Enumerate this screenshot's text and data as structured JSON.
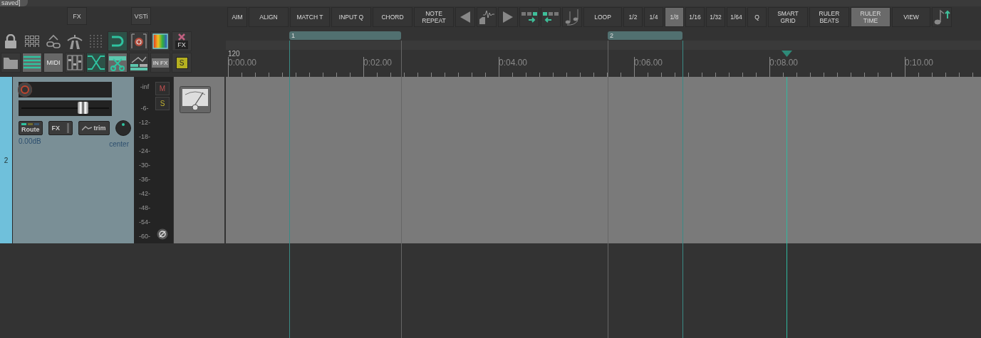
{
  "project_tab": {
    "title": "saved]"
  },
  "left_buttons": [
    {
      "label": "FX"
    },
    {
      "label": "VSTi"
    }
  ],
  "left_icon_rows": [
    [
      {
        "kind": "lock",
        "on": false
      },
      {
        "kind": "grid",
        "on": false
      },
      {
        "kind": "link",
        "on": false
      },
      {
        "kind": "road",
        "on": false
      },
      {
        "kind": "dots",
        "on": false
      },
      {
        "kind": "magnet",
        "on": true
      },
      {
        "kind": "record",
        "on": false
      },
      {
        "kind": "spectrum",
        "on": false
      },
      {
        "kind": "delete-fx",
        "label": "FX",
        "on": false
      }
    ],
    [
      {
        "kind": "folder",
        "on": false
      },
      {
        "kind": "lines",
        "on": true
      },
      {
        "kind": "text",
        "label": "MIDI",
        "on": true
      },
      {
        "kind": "mixer",
        "on": false
      },
      {
        "kind": "crossfade",
        "on": true
      },
      {
        "kind": "scissors",
        "on": true
      },
      {
        "kind": "envelope",
        "on": false
      },
      {
        "kind": "in-fx",
        "label": "IN FX",
        "on": false
      },
      {
        "kind": "solo",
        "label": "S",
        "on": false
      }
    ]
  ],
  "toolbar": [
    {
      "kind": "text",
      "label": "AIM",
      "selected": false
    },
    {
      "kind": "text",
      "label": "ALIGN",
      "selected": false
    },
    {
      "kind": "text",
      "label": "MATCH T",
      "selected": false
    },
    {
      "kind": "text",
      "label": "INPUT Q",
      "selected": false
    },
    {
      "kind": "text",
      "label": "CHORD",
      "selected": false
    },
    {
      "kind": "text",
      "label": "NOTE REPEAT",
      "selected": false
    },
    {
      "kind": "prev",
      "selected": false
    },
    {
      "kind": "wave",
      "selected": false
    },
    {
      "kind": "next",
      "selected": false
    },
    {
      "kind": "move-right",
      "selected": false
    },
    {
      "kind": "move-left",
      "selected": false
    },
    {
      "kind": "notes",
      "selected": false
    },
    {
      "kind": "text",
      "label": "LOOP",
      "selected": false
    },
    {
      "kind": "text",
      "label": "1/2",
      "selected": false
    },
    {
      "kind": "text",
      "label": "1/4",
      "selected": false
    },
    {
      "kind": "text",
      "label": "1/8",
      "selected": true
    },
    {
      "kind": "text",
      "label": "1/16",
      "selected": false
    },
    {
      "kind": "text",
      "label": "1/32",
      "selected": false
    },
    {
      "kind": "text",
      "label": "1/64",
      "selected": false
    },
    {
      "kind": "text",
      "label": "Q",
      "selected": false
    },
    {
      "kind": "text",
      "label": "SMART GRID",
      "selected": false
    },
    {
      "kind": "text",
      "label": "RULER BEATS",
      "selected": false
    },
    {
      "kind": "text",
      "label": "RULER TIME",
      "selected": true
    },
    {
      "kind": "text",
      "label": "VIEW",
      "selected": false
    },
    {
      "kind": "note-up",
      "selected": false
    }
  ],
  "regions": [
    {
      "label": "1"
    },
    {
      "label": "2"
    }
  ],
  "ruler": {
    "tempo": "120",
    "times": [
      "0:00.00",
      "0:02.00",
      "0:04.00",
      "0:06.00",
      "0:08.00",
      "0:10.00"
    ]
  },
  "track": {
    "number": "2",
    "fader": {
      "level": 0.7
    },
    "route": "Route",
    "fx": "FX",
    "trim": "trim",
    "volume": "0.00dB",
    "pan": "center",
    "mute": "M",
    "solo": "S",
    "meter_scale": [
      "-inf",
      "-6-",
      "-12-",
      "-18-",
      "-24-",
      "-30-",
      "-36-",
      "-42-",
      "-48-",
      "-54-",
      "-60-"
    ]
  }
}
